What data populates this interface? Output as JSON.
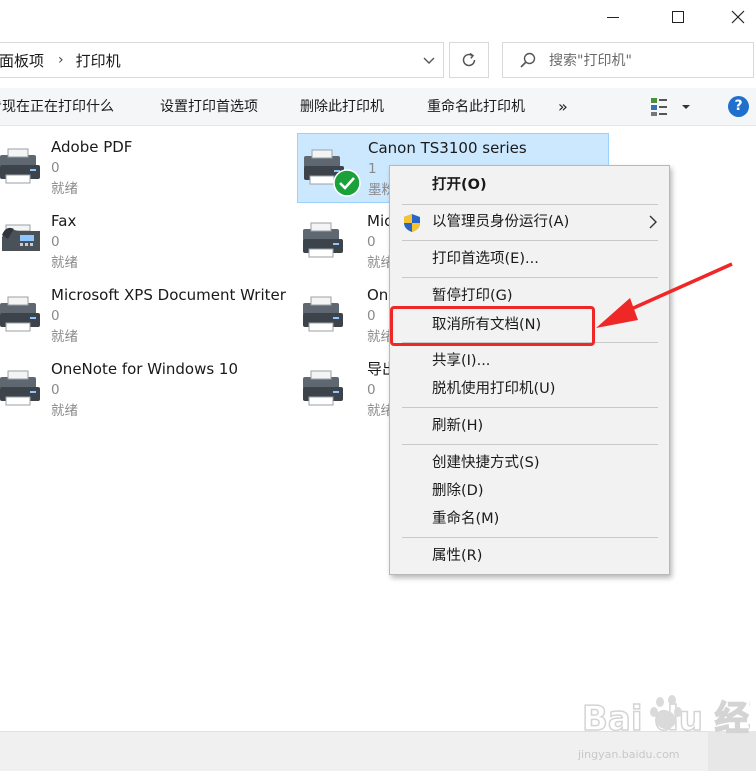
{
  "window": {
    "minimize_glyph": "—",
    "maximize_glyph": "☐",
    "close_glyph": "✕"
  },
  "address": {
    "crumb_parent": "面板项",
    "crumb_current": "打印机",
    "separator": "›"
  },
  "search": {
    "placeholder": "搜索\"打印机\""
  },
  "toolbar": {
    "see_whats_printing": "看现在正在打印什么",
    "set_print_prefs": "设置打印首选项",
    "delete_printer": "删除此打印机",
    "rename_printer": "重命名此打印机",
    "more": "»",
    "help": "?"
  },
  "devices": [
    {
      "name": "Adobe PDF",
      "count": "0",
      "status": "就绪"
    },
    {
      "name": "Fax",
      "count": "0",
      "status": "就绪"
    },
    {
      "name": "Microsoft XPS Document Writer",
      "count": "0",
      "status": "就绪"
    },
    {
      "name": "OneNote for Windows 10",
      "count": "0",
      "status": "就绪"
    },
    {
      "name": "Canon TS3100 series",
      "count": "1",
      "status": "墨粉"
    },
    {
      "name": "Mic",
      "count": "0",
      "status": "就绪"
    },
    {
      "name": "On",
      "count": "0",
      "status": "就绪"
    },
    {
      "name": "导出",
      "count": "0",
      "status": "就绪"
    }
  ],
  "context_menu": {
    "open": "打开(O)",
    "run_as_admin": "以管理员身份运行(A)",
    "print_prefs": "打印首选项(E)...",
    "pause": "暂停打印(G)",
    "cancel_all": "取消所有文档(N)",
    "share": "共享(I)...",
    "offline": "脱机使用打印机(U)",
    "refresh": "刷新(H)",
    "shortcut": "创建快捷方式(S)",
    "delete": "删除(D)",
    "rename": "重命名(M)",
    "properties": "属性(R)"
  },
  "watermark": {
    "logo_text": "Bai du 经验",
    "url": "jingyan.baidu.com"
  },
  "colors": {
    "accent": "#1f6fcc",
    "selection": "#cce8ff",
    "annotation_red": "#ef2727",
    "status_ok": "#1aa13a"
  }
}
